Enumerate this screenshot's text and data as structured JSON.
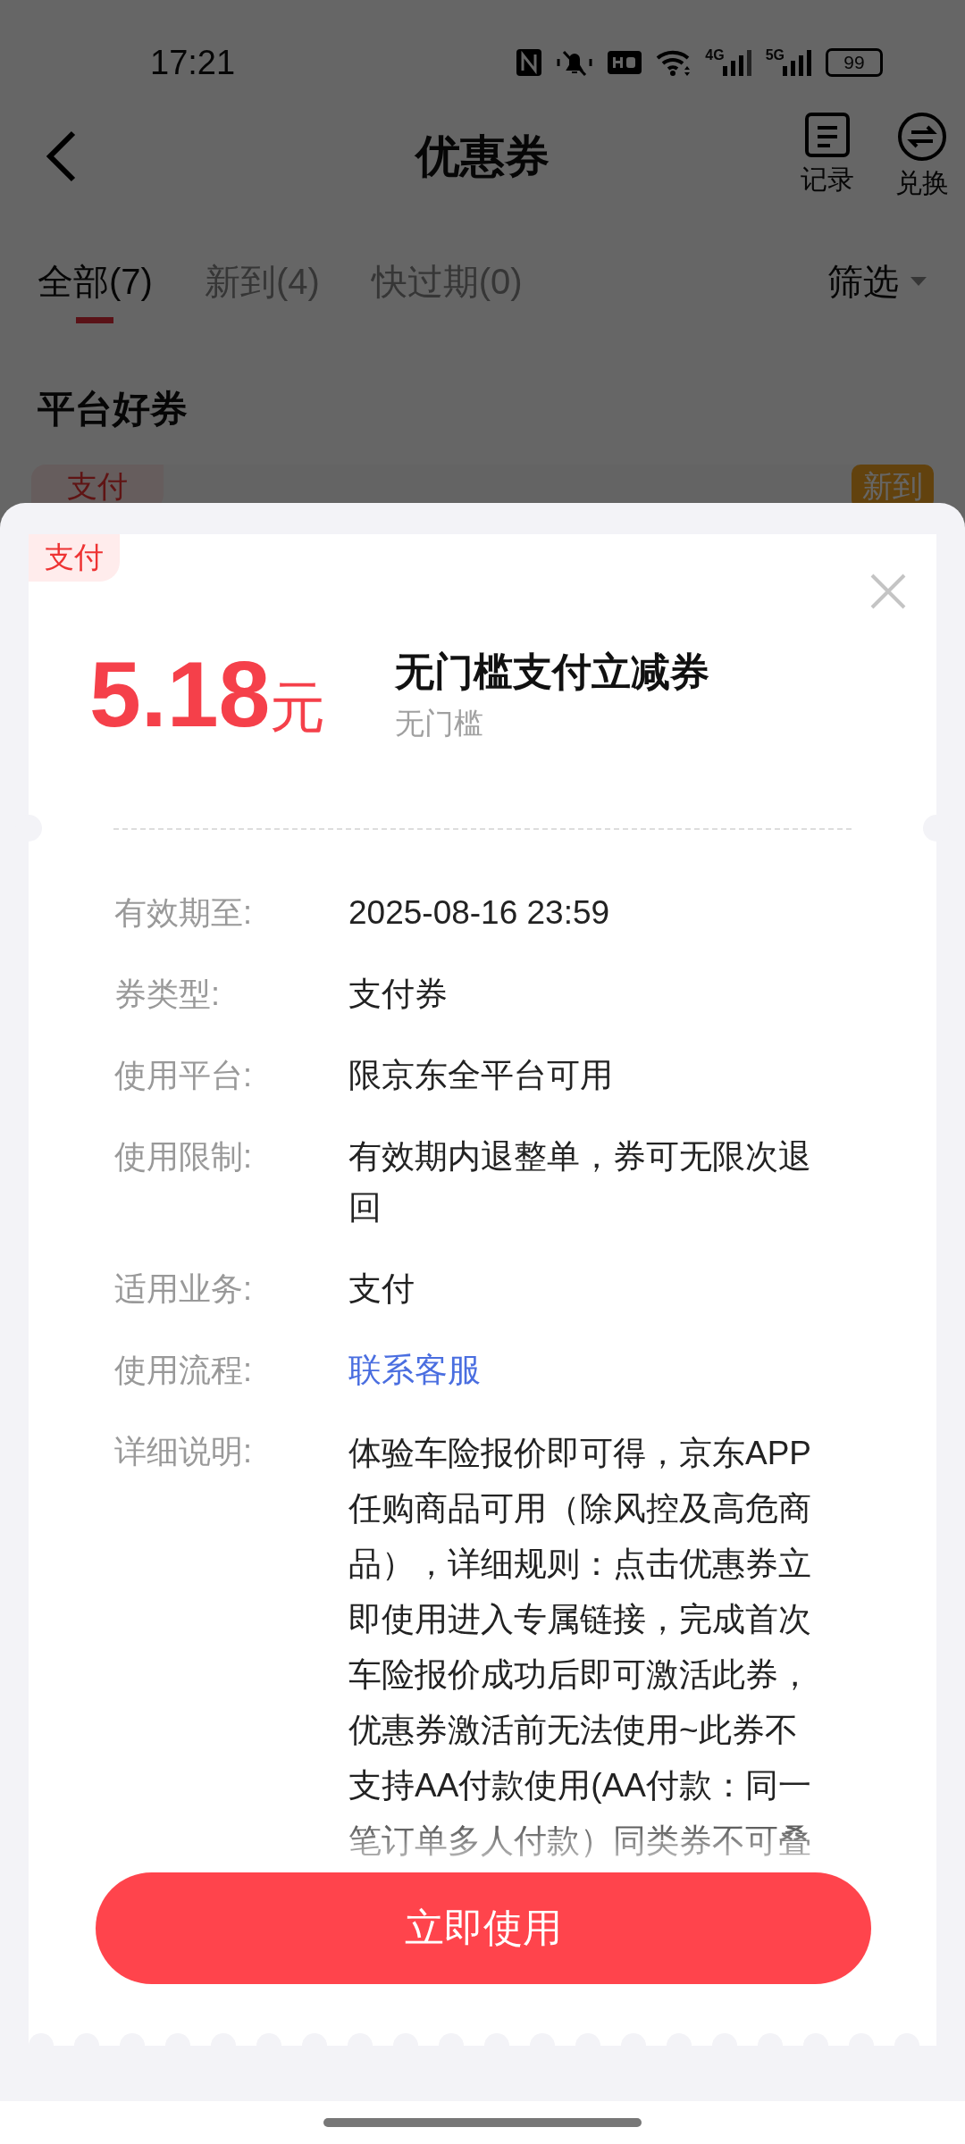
{
  "status_bar": {
    "time": "17:21",
    "networks": [
      {
        "label": "4G"
      },
      {
        "label": "5G"
      }
    ],
    "battery": "99"
  },
  "header": {
    "title": "优惠券",
    "actions": [
      {
        "kind": "record",
        "label": "记录"
      },
      {
        "kind": "exchange",
        "label": "兑换"
      }
    ]
  },
  "tabs": [
    {
      "label": "全部(7)",
      "selected": true
    },
    {
      "label": "新到(4)",
      "selected": false
    },
    {
      "label": "快过期(0)",
      "selected": false
    }
  ],
  "filter": {
    "label": "筛选"
  },
  "section": {
    "title": "平台好券"
  },
  "background_coupon": {
    "tag": "支付",
    "badge": "新到"
  },
  "sheet": {
    "tag": "支付",
    "amount": "5.18",
    "unit": "元",
    "title": "无门槛支付立减券",
    "subtitle": "无门槛",
    "details": [
      {
        "label": "有效期至:",
        "value": "2025-08-16 23:59",
        "kind": "text"
      },
      {
        "label": "券类型:",
        "value": "支付券",
        "kind": "text"
      },
      {
        "label": "使用平台:",
        "value": "限京东全平台可用",
        "kind": "text"
      },
      {
        "label": "使用限制:",
        "value": "有效期内退整单，券可无限次退回",
        "kind": "text"
      },
      {
        "label": "适用业务:",
        "value": "支付",
        "kind": "text"
      },
      {
        "label": "使用流程:",
        "value": "联系客服",
        "kind": "link"
      },
      {
        "label": "详细说明:",
        "value": "体验车险报价即可得，京东APP任购商品可用（除风控及高危商品），详细规则：点击优惠券立即使用进入专属链接，完成首次车险报价成功后即可激活此券，优惠券激活前无法使用~此券不支持AA付款使用(AA付款：同一笔订单多人付款）同类券不可叠",
        "kind": "note"
      }
    ],
    "button": "立即使用"
  }
}
